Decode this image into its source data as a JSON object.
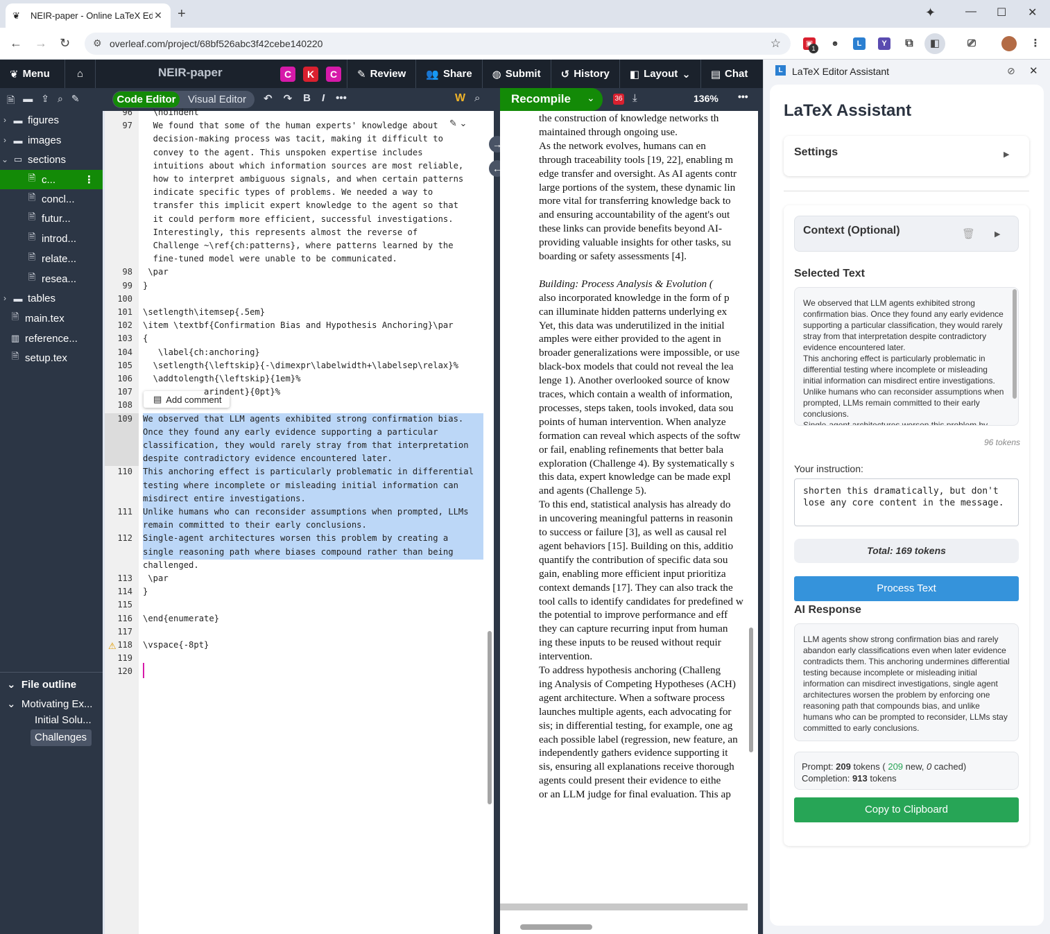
{
  "browser": {
    "tab_title": "NEIR-paper - Online LaTeX Editor",
    "tab_title_display": "NEIR-paper - Online LaTeX Edit",
    "url": "overleaf.com/project/68bf526abc3f42cebe140220",
    "extension_badge": "1"
  },
  "overleaf": {
    "menu_label": "Menu",
    "project_title": "NEIR-paper",
    "collaborators": [
      "C",
      "K",
      "C"
    ],
    "collaborator_colors": [
      "#d61aa9",
      "#d9202f",
      "#d61aa9"
    ],
    "toolbar": [
      "Review",
      "Share",
      "Submit",
      "History",
      "Layout",
      "Chat"
    ],
    "code_editor_label": "Code Editor",
    "visual_editor_label": "Visual Editor",
    "recompile_label": "Recompile",
    "error_count": "36",
    "zoom": "136%",
    "add_comment": "Add comment",
    "accent_green": "#138a07"
  },
  "file_tree": [
    {
      "label": "figures",
      "type": "folder",
      "level": 0
    },
    {
      "label": "images",
      "type": "folder",
      "level": 0
    },
    {
      "label": "sections",
      "type": "folder-open",
      "level": 0
    },
    {
      "label": "c...",
      "type": "file",
      "level": 1,
      "selected": true
    },
    {
      "label": "concl...",
      "type": "file",
      "level": 1
    },
    {
      "label": "futur...",
      "type": "file",
      "level": 1
    },
    {
      "label": "introd...",
      "type": "file",
      "level": 1
    },
    {
      "label": "relate...",
      "type": "file",
      "level": 1
    },
    {
      "label": "resea...",
      "type": "file",
      "level": 1
    },
    {
      "label": "tables",
      "type": "folder",
      "level": 0
    },
    {
      "label": "main.tex",
      "type": "file",
      "level": 0
    },
    {
      "label": "reference...",
      "type": "book",
      "level": 0
    },
    {
      "label": "setup.tex",
      "type": "file",
      "level": 0
    }
  ],
  "outline": {
    "title": "File outline",
    "items": [
      "Motivating Ex...",
      "Initial Solu...",
      "Challenges"
    ]
  },
  "line_numbers": [
    "96",
    "97",
    "",
    "",
    "",
    "",
    "",
    "",
    "",
    "",
    "",
    "",
    "98",
    "99",
    "100",
    "101",
    "102",
    "103",
    "104",
    "105",
    "106",
    "107",
    "108",
    "109",
    "",
    "",
    "",
    "110",
    "",
    "",
    "111",
    "",
    "112",
    "",
    "",
    "113",
    "114",
    "115",
    "116",
    "117",
    "118",
    "119",
    "120"
  ],
  "code_lines": [
    "  \\noindent",
    "  We found that some of the human experts' knowledge about",
    "  decision-making process was tacit, making it difficult to",
    "  convey to the agent. This unspoken expertise includes",
    "  intuitions about which information sources are most reliable,",
    "  how to interpret ambiguous signals, and when certain patterns",
    "  indicate specific types of problems. We needed a way to",
    "  transfer this implicit expert knowledge to the agent so that",
    "  it could perform more efficient, successful investigations.",
    "  Interestingly, this represents almost the reverse of",
    "  Challenge ~\\ref{ch:patterns}, where patterns learned by the",
    "  fine-tuned model were unable to be communicated.",
    " \\par",
    "}",
    "",
    "\\setlength\\itemsep{.5em}",
    "\\item \\textbf{Confirmation Bias and Hypothesis Anchoring}\\par",
    "{",
    "   \\label{ch:anchoring}",
    "  \\setlength{\\leftskip}{-\\dimexpr\\labelwidth+\\labelsep\\relax}%",
    "  \\addtolength{\\leftskip}{1em}%",
    "            arindent}{0pt}%",
    "",
    "We observed that LLM agents exhibited strong confirmation bias.",
    "Once they found any early evidence supporting a particular",
    "classification, they would rarely stray from that interpretation",
    "despite contradictory evidence encountered later.",
    "This anchoring effect is particularly problematic in differential",
    "testing where incomplete or misleading initial information can",
    "misdirect entire investigations.",
    "Unlike humans who can reconsider assumptions when prompted, LLMs",
    "remain committed to their early conclusions.",
    "Single-agent architectures worsen this problem by creating a",
    "single reasoning path where biases compound rather than being",
    "challenged.",
    " \\par",
    "}",
    "",
    "\\end{enumerate}",
    "",
    "\\vspace{-8pt}",
    "",
    ""
  ],
  "pdf_lines": [
    "the construction of knowledge networks th",
    "maintained through ongoing use.",
    "    As the network evolves, humans can en",
    "through traceability tools [19, 22], enabling m",
    "edge transfer and oversight. As AI agents contr",
    "large portions of the system, these dynamic lin",
    "more vital for transferring knowledge back to",
    "and ensuring accountability of the agent's out",
    "these links can provide benefits beyond AI-",
    "providing valuable insights for other tasks, su",
    "boarding or safety assessments [4].",
    "",
    "    Building: Process Analysis & Evolution (",
    "also incorporated knowledge in the form of p",
    "can illuminate hidden patterns underlying ex",
    "Yet, this data was underutilized in the initial",
    "amples were either provided to the agent in",
    "broader generalizations were impossible, or use",
    "black-box models that could not reveal the lea",
    "lenge 1). Another overlooked source of know",
    "traces, which contain a wealth of information,",
    "processes, steps taken, tools invoked, data sou",
    "points of human intervention. When analyze",
    "formation can reveal which aspects of the softw",
    "or fail, enabling refinements that better bala",
    "exploration (Challenge 4). By systematically s",
    "this data, expert knowledge can be made expl",
    "and agents (Challenge 5).",
    "    To this end, statistical analysis has already do",
    "in uncovering meaningful patterns in reasonin",
    "to success or failure [3], as well as causal rel",
    "agent behaviors [15]. Building on this, additio",
    "quantify the contribution of specific data sou",
    "gain, enabling more efficient input prioritiza",
    "context demands [17]. They can also track the",
    "tool calls to identify candidates for predefined w",
    "the potential to improve performance and eff",
    "they can capture recurring input from human",
    "ing these inputs to be reused without requir",
    "intervention.",
    "    To address hypothesis anchoring (Challeng",
    "ing Analysis of Competing Hypotheses (ACH)",
    "agent architecture. When a software process",
    "launches multiple agents, each advocating for",
    "sis; in differential testing, for example, one ag",
    "each possible label (regression, new feature, an",
    "independently gathers evidence supporting it",
    "sis, ensuring all explanations receive thorough",
    "agents could present their evidence to eithe",
    "or an LLM judge for final evaluation. This ap"
  ],
  "assistant": {
    "panel_title": "LaTeX Editor Assistant",
    "heading": "LaTeX Assistant",
    "settings_label": "Settings",
    "context_label": "Context (Optional)",
    "selected_text_label": "Selected Text",
    "selected_text": "We observed that LLM agents exhibited strong confirmation bias. Once they found any early evidence supporting a particular classification, they would rarely stray from that interpretation despite contradictory evidence encountered later.\nThis anchoring effect is particularly problematic in differential testing where incomplete or misleading initial information can misdirect entire investigations.\nUnlike humans who can reconsider assumptions when prompted, LLMs remain committed to their early conclusions.\nSingle-agent architectures worsen this problem by",
    "selected_tokens": "96 tokens",
    "instruction_label": "Your instruction:",
    "instruction_value": "shorten this dramatically, but don't lose any core content in the message.",
    "total_tokens": "Total: 169 tokens",
    "process_button": "Process Text",
    "ai_response_label": "AI Response",
    "ai_response": "LLM agents show strong confirmation bias and rarely abandon early classifications even when later evidence contradicts them. This anchoring undermines differential testing because incomplete or misleading initial information can misdirect investigations, single agent architectures worsen the problem by enforcing one reasoning path that compounds bias, and unlike humans who can be prompted to reconsider, LLMs stay committed to early conclusions.",
    "prompt_label": "Prompt:",
    "prompt_tokens": "209",
    "tokens_word": "tokens",
    "prompt_new": "209",
    "new_word": "new,",
    "prompt_cached": "0",
    "cached_word": "cached)",
    "completion_label": "Completion:",
    "completion_tokens": "913",
    "copy_button": "Copy to Clipboard",
    "process_color": "#3593db",
    "copy_color": "#27a556"
  }
}
